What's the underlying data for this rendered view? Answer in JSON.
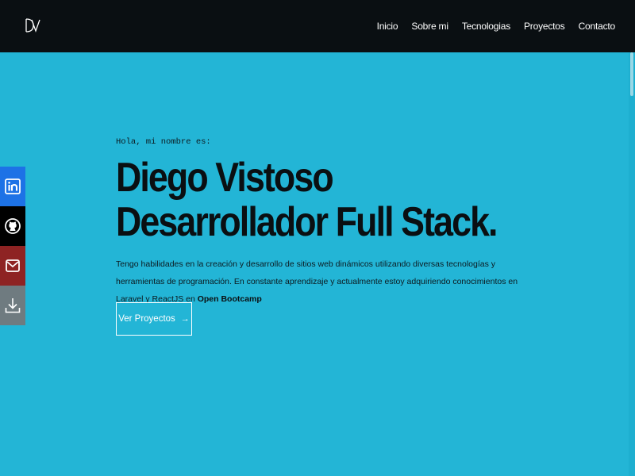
{
  "navbar": {
    "logo_text": "DV",
    "links": [
      "Inicio",
      "Sobre mi",
      "Tecnologias",
      "Proyectos",
      "Contacto"
    ]
  },
  "social_bar": {
    "items": [
      {
        "icon": "linkedin-icon",
        "color": "#1d72e6"
      },
      {
        "icon": "github-icon",
        "color": "#000000"
      },
      {
        "icon": "email-icon",
        "color": "#8e2323"
      },
      {
        "icon": "download-icon",
        "color": "#6f7b80"
      }
    ]
  },
  "hero": {
    "greeting": "Hola, mi nombre es:",
    "name": "Diego Vistoso",
    "role": "Desarrollador Full Stack.",
    "description_main": "Tengo habilidades en la creación y desarrollo de sitios web dinámicos utilizando diversas tecnologías y herramientas de programación. En constante aprendizaje y actualmente estoy adquiriendo conocimientos en Laravel y ReactJS en ",
    "description_highlight": "Open Bootcamp",
    "cta_label": "Ver Proyectos",
    "cta_arrow": "→"
  },
  "colors": {
    "background": "#23b5d6",
    "navbar": "#0a0f12",
    "text_dark": "#0a0f12",
    "cta_border": "#ffffff"
  }
}
